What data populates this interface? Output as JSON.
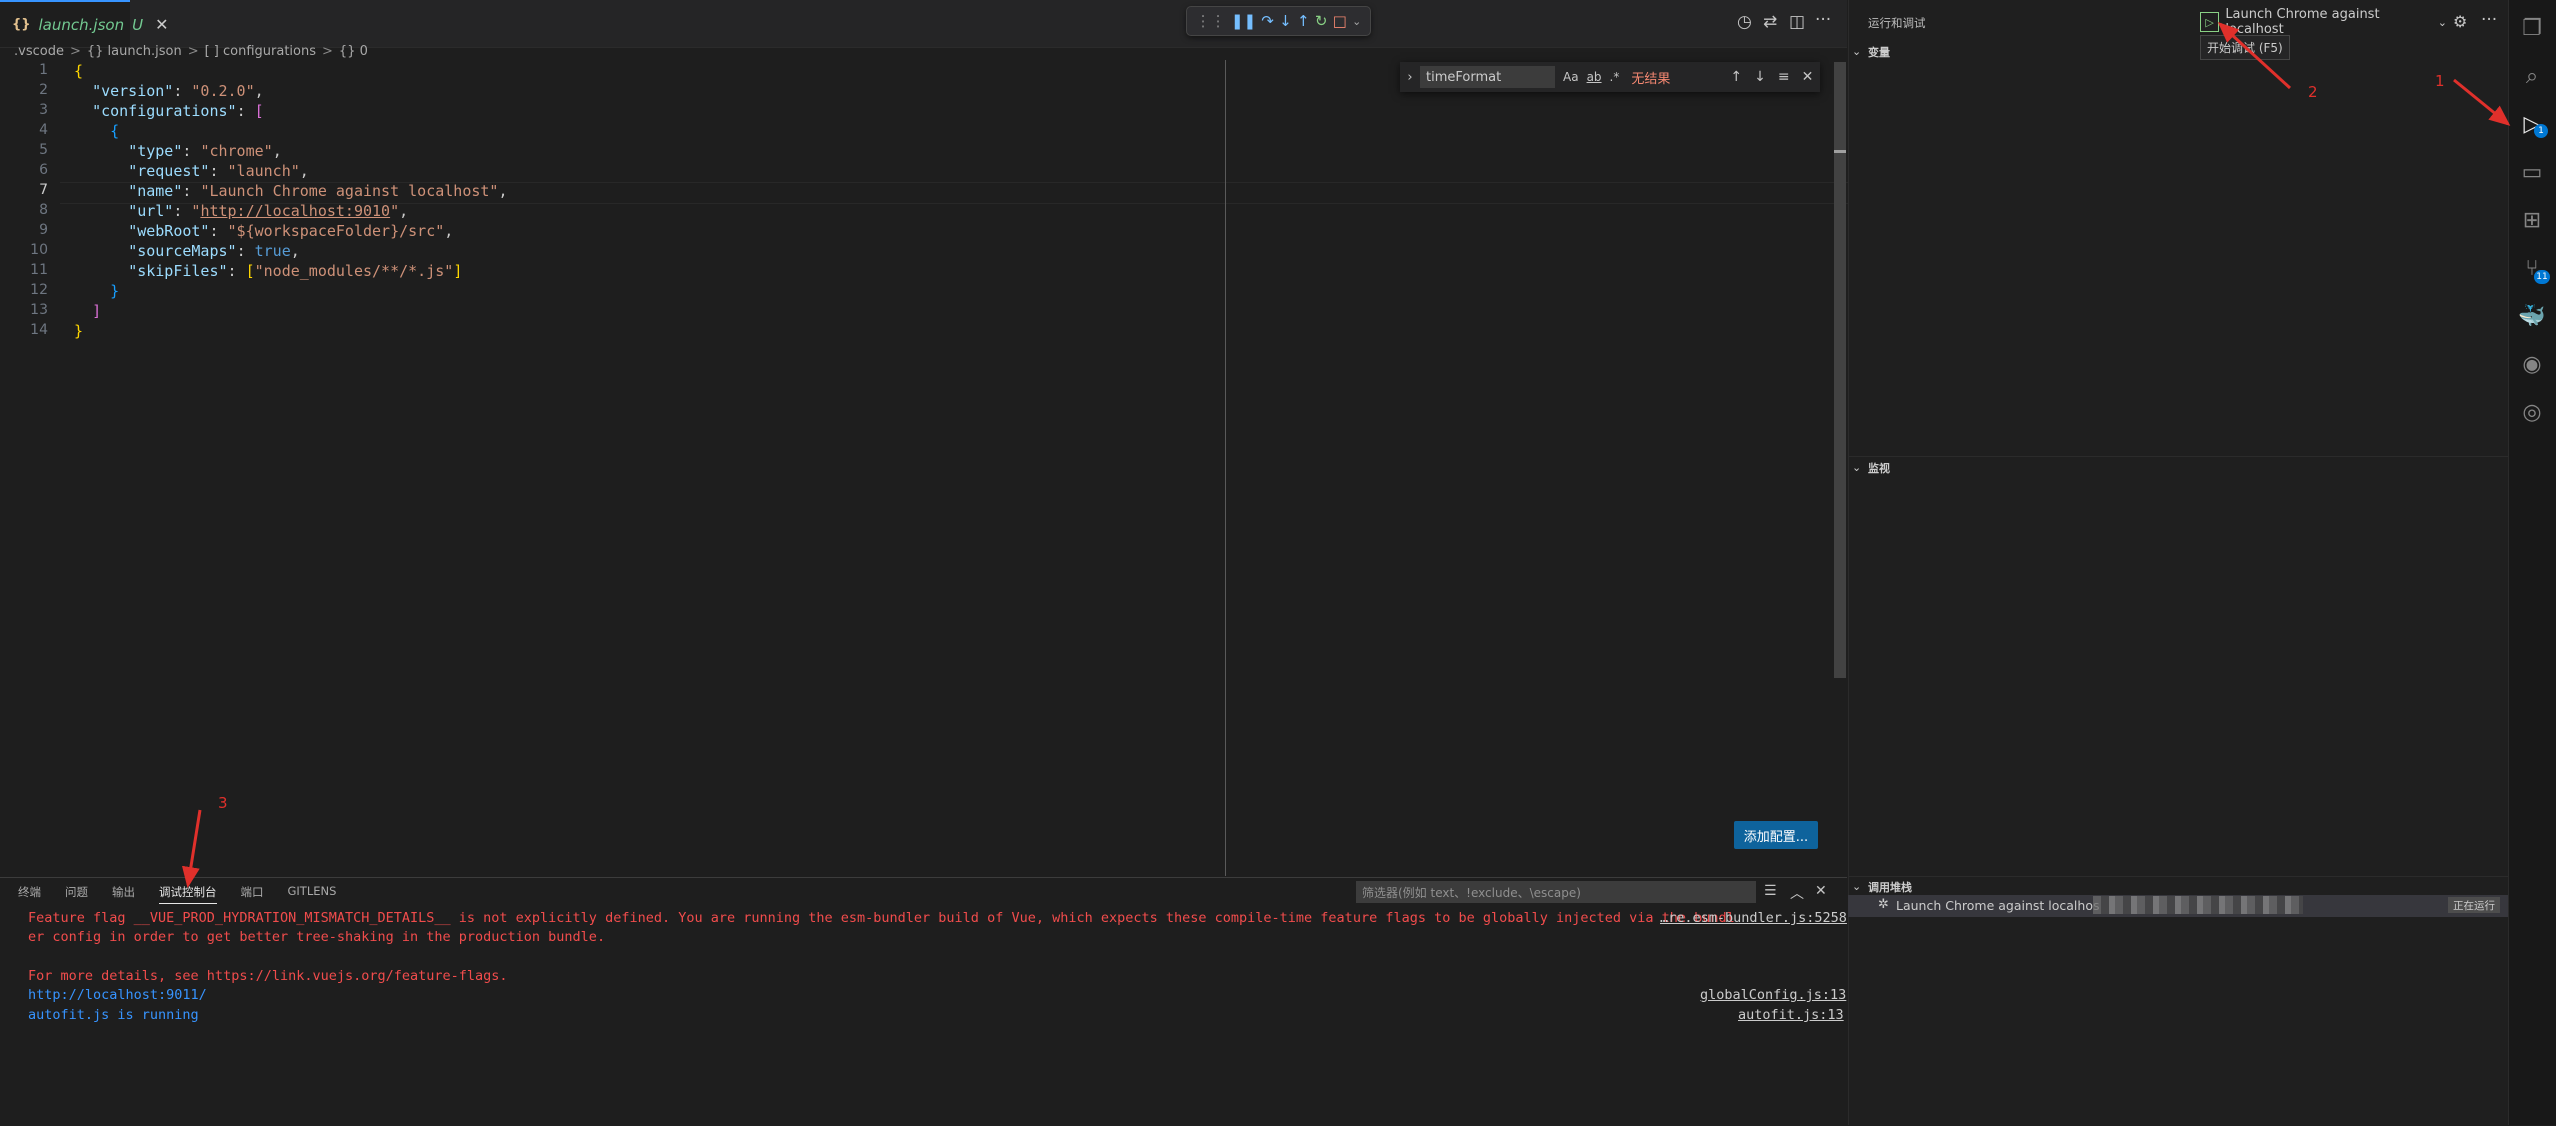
{
  "tab": {
    "icon": "{}",
    "name": "launch.json",
    "status": "U",
    "close": "✕"
  },
  "breadcrumb": [
    ".vscode",
    ">",
    "{} launch.json",
    ">",
    "[ ] configurations",
    ">",
    "{} 0"
  ],
  "editor": {
    "line_numbers": [
      "1",
      "2",
      "3",
      "4",
      "5",
      "6",
      "7",
      "8",
      "9",
      "10",
      "11",
      "12",
      "13",
      "14"
    ]
  },
  "find_widget": {
    "query": "timeFormat",
    "opt_case": "Aa",
    "opt_word": "ab",
    "opt_regex": ".*",
    "result": "无结果"
  },
  "add_config_button": "添加配置...",
  "panel": {
    "tabs": [
      "终端",
      "问题",
      "输出",
      "调试控制台",
      "端口",
      "GITLENS"
    ],
    "active_tab": "调试控制台",
    "filter_placeholder": "筛选器(例如 text、!exclude、\\escape)",
    "console": {
      "line1": "Feature flag __VUE_PROD_HYDRATION_MISMATCH_DETAILS__ is not explicitly defined. You are running the esm-bundler build of Vue, which expects these compile-time feature flags to be globally injected via the bundl",
      "line1_src": "…re.esm-bundler.js:5258",
      "line2": "er config in order to get better tree-shaking in the production bundle.",
      "line3": "For more details, see https://link.vuejs.org/feature-flags.",
      "line4": "http://localhost:9011/",
      "line4_src": "globalConfig.js:13",
      "line5": "autofit.js is running",
      "line5_src": "autofit.js:13"
    }
  },
  "sidebar": {
    "title": "运行和调试",
    "launch_config": "Launch Chrome against localhost",
    "tooltip": "开始调试 (F5)",
    "sections": {
      "variables": "变量",
      "watch": "监视",
      "callstack": "调用堆栈"
    },
    "callstack_item": "Launch Chrome against localhos",
    "callstack_status": "正在运行"
  },
  "activity_badges": {
    "debug": "1",
    "scm": "11"
  },
  "annotations": {
    "a1": "1",
    "a2": "2",
    "a3": "3"
  },
  "colors": {
    "accent": "#0078d4",
    "error": "#f14c4c",
    "annotation": "#e0302b",
    "button": "#0e639c"
  }
}
